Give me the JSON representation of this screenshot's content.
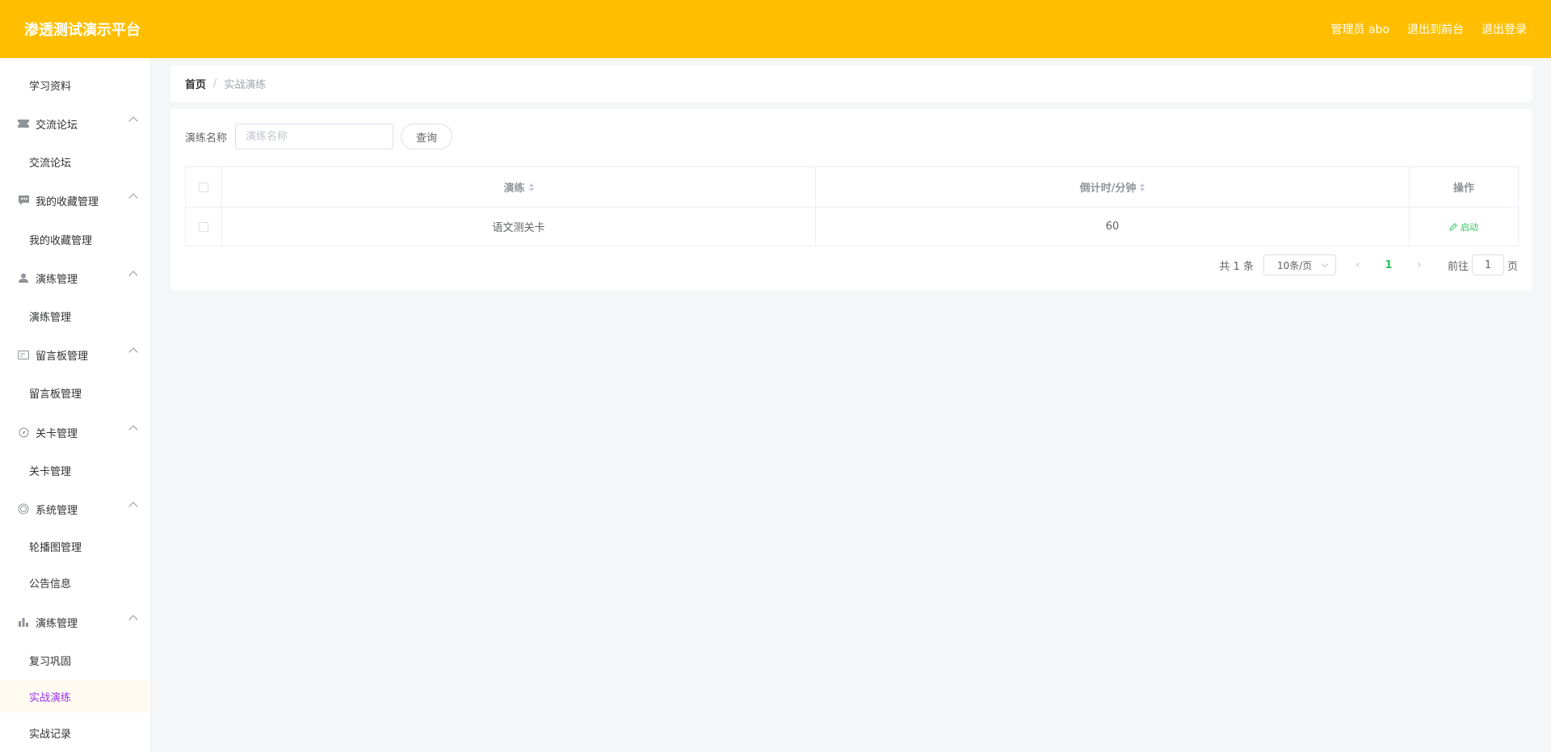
{
  "header": {
    "brand": "渗透测试演示平台",
    "admin": "管理员 abo",
    "to_front": "退出到前台",
    "logout": "退出登录"
  },
  "sidebar": {
    "top_item": "学习资料",
    "groups": [
      {
        "title": "交流论坛",
        "icon": "ticket-icon",
        "items": [
          "交流论坛"
        ]
      },
      {
        "title": "我的收藏管理",
        "icon": "chat-bubble-icon",
        "items": [
          "我的收藏管理"
        ]
      },
      {
        "title": "演练管理",
        "icon": "user-icon",
        "items": [
          "演练管理"
        ]
      },
      {
        "title": "留言板管理",
        "icon": "message-card-icon",
        "items": [
          "留言板管理"
        ]
      },
      {
        "title": "关卡管理",
        "icon": "compass-icon",
        "items": [
          "关卡管理"
        ]
      },
      {
        "title": "系统管理",
        "icon": "globe-icon",
        "items": [
          "轮播图管理",
          "公告信息"
        ]
      },
      {
        "title": "演练管理",
        "icon": "bar-chart-icon",
        "items": [
          "复习巩固",
          "实战演练",
          "实战记录"
        ]
      }
    ],
    "active_item": "实战演练"
  },
  "breadcrumb": {
    "home": "首页",
    "separator": "/",
    "current": "实战演练"
  },
  "search": {
    "label": "演练名称",
    "placeholder": "演练名称",
    "value": "",
    "button": "查询"
  },
  "table": {
    "columns": [
      "演练",
      "倒计时/分钟",
      "操作"
    ],
    "rows": [
      {
        "name": "语文测关卡",
        "countdown": "60",
        "action": "启动"
      }
    ]
  },
  "pagination": {
    "total": "共 1 条",
    "page_size": "10条/页",
    "current_page": "1",
    "goto_label": "前往",
    "goto_value": "1",
    "page_suffix": "页"
  },
  "colors": {
    "header_bg": "#ffbf00",
    "active_menu_text": "#9b34f0",
    "accent_green": "#2fc25b"
  }
}
